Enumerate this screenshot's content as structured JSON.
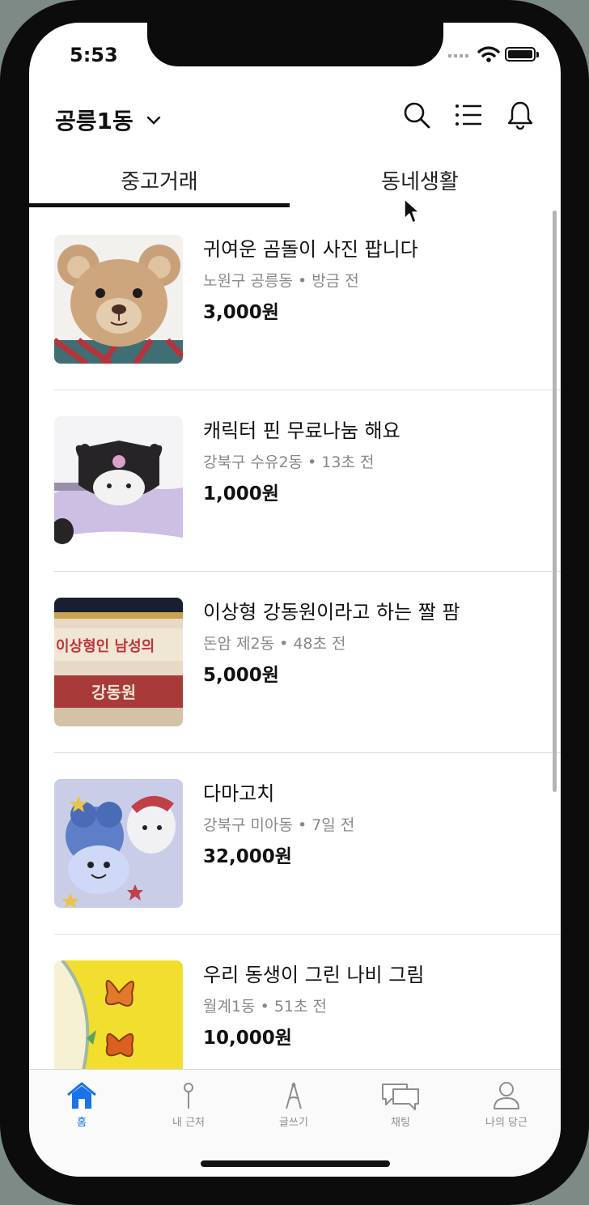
{
  "status_bar": {
    "time": "5:53"
  },
  "header": {
    "location": "공릉1동"
  },
  "tabs": [
    {
      "label": "중고거래",
      "active": true
    },
    {
      "label": "동네생활",
      "active": false
    }
  ],
  "items": [
    {
      "title": "귀여운 곰돌이 사진 팝니다",
      "meta": "노원구 공릉동 • 방금 전",
      "price": "3,000원"
    },
    {
      "title": "캐릭터 핀 무료나눔 해요",
      "meta": "강북구 수유2동 • 13초 전",
      "price": "1,000원"
    },
    {
      "title": "이상형 강동원이라고 하는 짤 팜",
      "meta": "돈암 제2동 • 48초 전",
      "price": "5,000원",
      "image_text": [
        "이상형인 남성의",
        "강동원"
      ]
    },
    {
      "title": "다마고치",
      "meta": "강북구 미아동 • 7일 전",
      "price": "32,000원"
    },
    {
      "title": "우리 동생이 그린 나비 그림",
      "meta": "월계1동 • 51초 전",
      "price": "10,000원"
    }
  ],
  "bottom_nav": [
    {
      "label": "홈",
      "icon": "home-icon",
      "active": true
    },
    {
      "label": "내 근처",
      "icon": "map-pin-icon",
      "active": false
    },
    {
      "label": "글쓰기",
      "icon": "compass-pen-icon",
      "active": false
    },
    {
      "label": "채팅",
      "icon": "chat-bubbles-icon",
      "active": false
    },
    {
      "label": "나의 당근",
      "icon": "person-icon",
      "active": false
    }
  ],
  "colors": {
    "accent": "#1a73e8",
    "text": "#111111",
    "meta": "#888888"
  }
}
